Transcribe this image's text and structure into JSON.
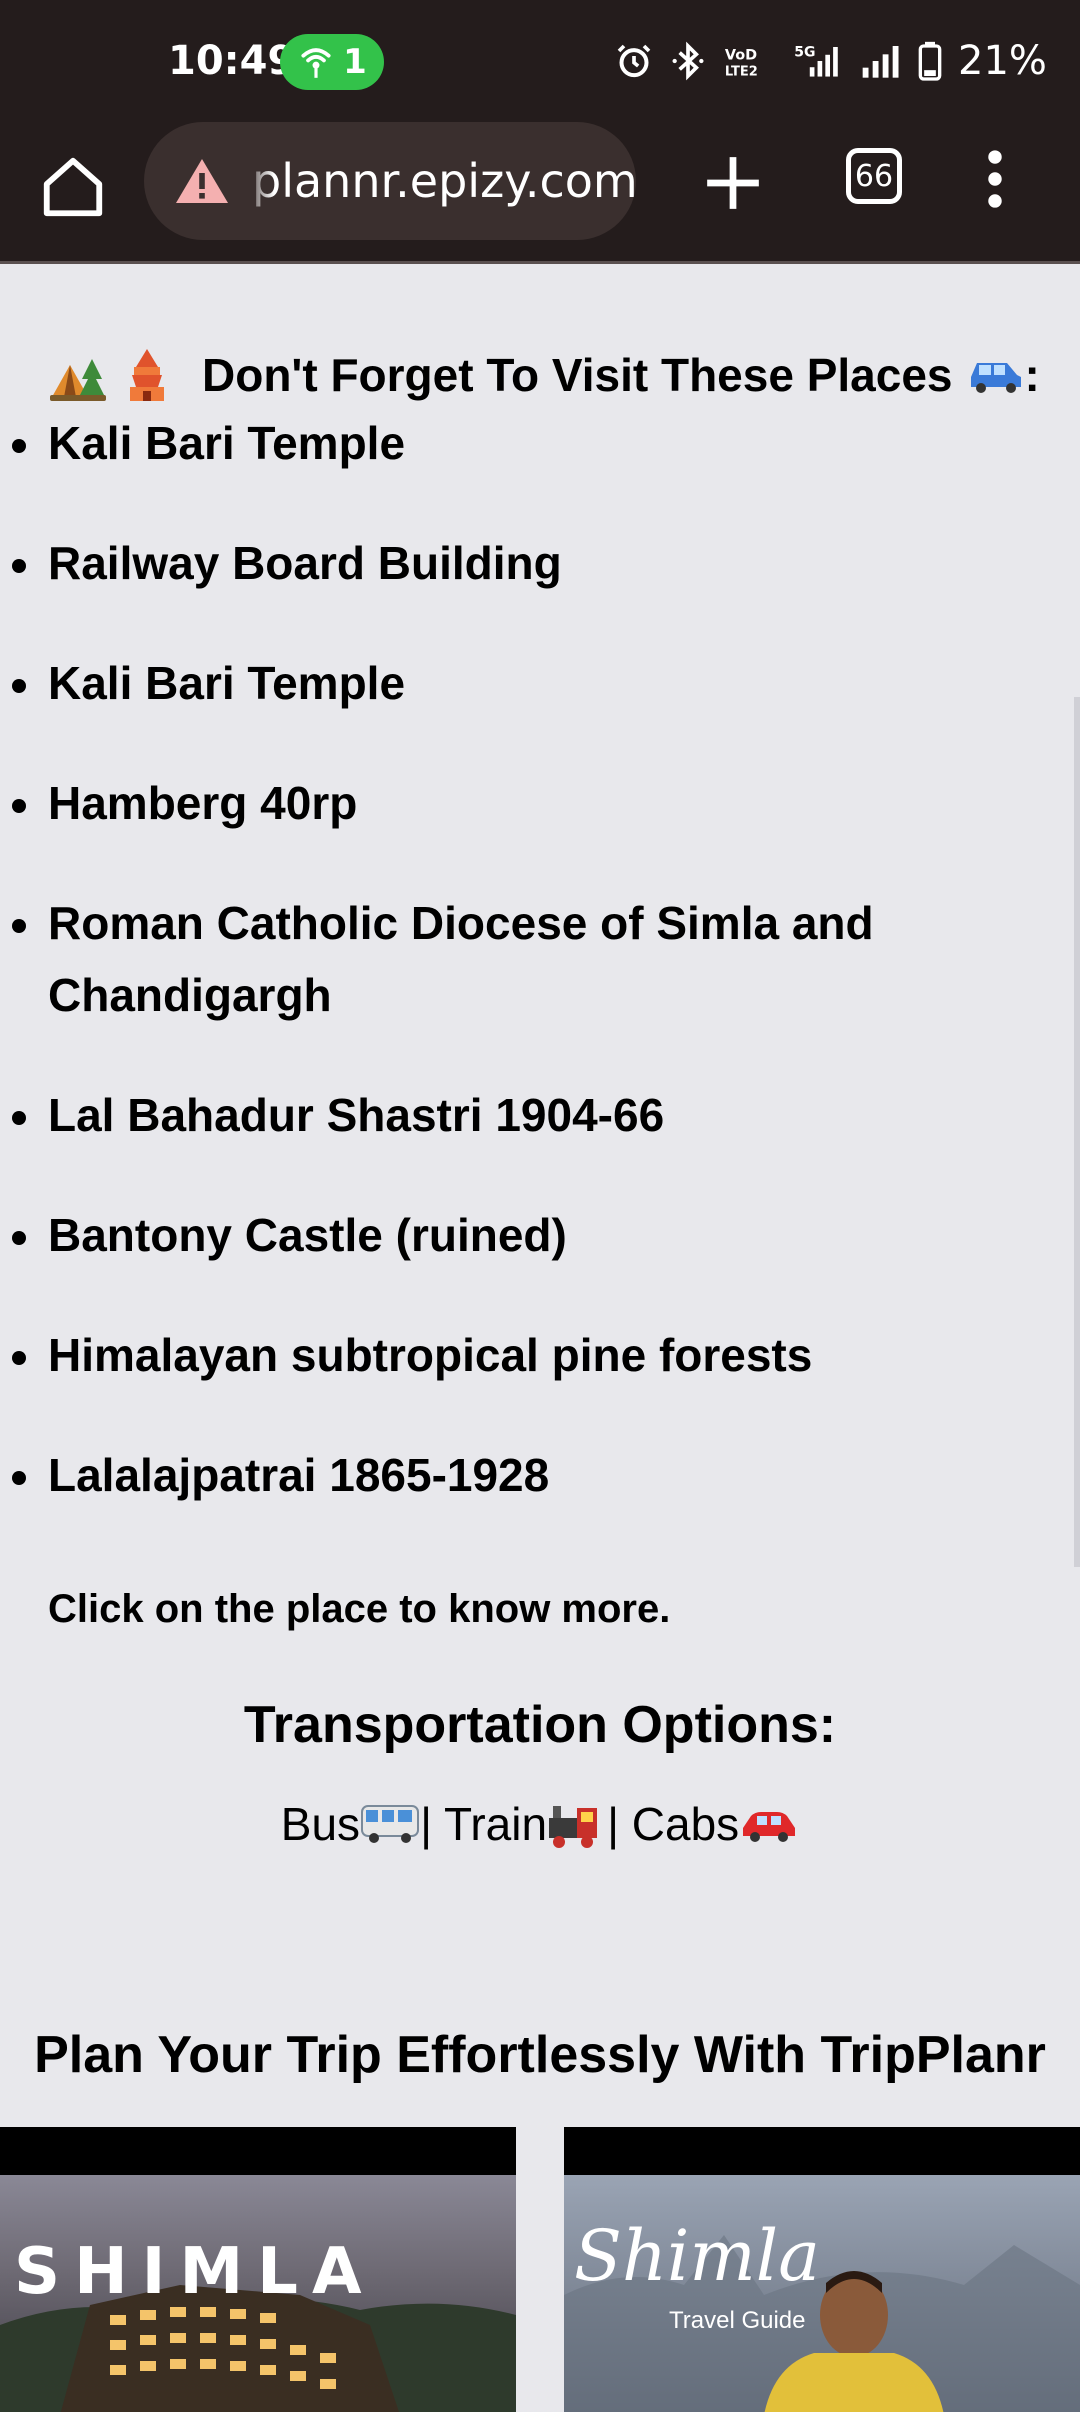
{
  "status_bar": {
    "time": "10:49",
    "hotspot_count": "1",
    "battery_percent": "21%",
    "icons": [
      "alarm-icon",
      "bluetooth-icon",
      "volte-icon",
      "5g-signal-icon",
      "signal-icon",
      "battery-icon"
    ]
  },
  "toolbar": {
    "url": "plannr.epizy.com",
    "tab_count": "66",
    "colors": {
      "background": "#241c1c",
      "urlbar": "#3a2f2e",
      "warning": "#f4b0b0"
    }
  },
  "page": {
    "visit_heading": "Don't Forget To Visit These Places",
    "visit_heading_suffix": ":",
    "places": [
      "Kali Bari Temple",
      "Railway Board Building",
      "Kali Bari Temple",
      "Hamberg 40rp",
      "Roman Catholic Diocese of Simla and Chandigargh",
      "Lal Bahadur Shastri 1904-66",
      "Bantony Castle (ruined)",
      "Himalayan subtropical pine forests",
      "Lalalajpatrai 1865-1928"
    ],
    "click_hint": "Click on the place to know more.",
    "transport_heading": "Transportation Options:",
    "transport": {
      "bus": "Bus",
      "sep1": "| Train",
      "sep2": " | Cabs"
    },
    "plan_heading": "Plan Your Trip Effortlessly With TripPlanr",
    "videos": {
      "shimla_title": "SHIMLA",
      "guide_title": "Shimla",
      "guide_subtitle": "Travel Guide"
    }
  }
}
